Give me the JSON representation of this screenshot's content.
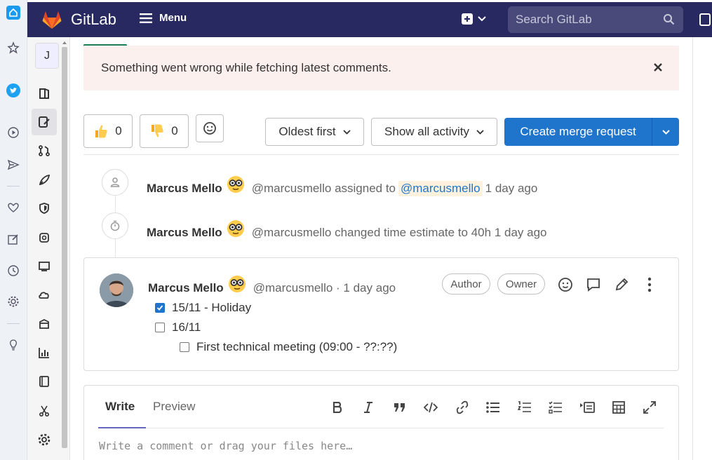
{
  "header": {
    "brand": "GitLab",
    "menu_label": "Menu",
    "search_placeholder": "Search GitLab"
  },
  "project": {
    "avatar_letter": "J"
  },
  "alert": {
    "message": "Something went wrong while fetching latest comments."
  },
  "toolbar": {
    "thumbs_up_count": "0",
    "thumbs_down_count": "0",
    "sort_label": "Oldest first",
    "filter_label": "Show all activity",
    "create_mr_label": "Create merge request"
  },
  "activity": [
    {
      "author": "Marcus Mello",
      "username": "@marcusmello",
      "action": "assigned to",
      "mention": "@marcusmello",
      "time": "1 day ago"
    },
    {
      "author": "Marcus Mello",
      "username": "@marcusmello",
      "action": "changed time estimate to 40h",
      "time": "1 day ago"
    }
  ],
  "note": {
    "author": "Marcus Mello",
    "meta": "@marcusmello · 1 day ago",
    "badges": [
      "Author",
      "Owner"
    ],
    "tasks": [
      {
        "text": "15/11 - Holiday",
        "checked": true
      },
      {
        "text": "16/11",
        "checked": false
      },
      {
        "text": "First technical meeting (09:00 - ??:??)",
        "checked": false
      }
    ]
  },
  "comment": {
    "tab_write": "Write",
    "tab_preview": "Preview",
    "placeholder": "Write a comment or drag your files here…"
  },
  "colors": {
    "header_bg": "#292961",
    "primary": "#1f75cb",
    "alert_bg": "#fbf0ee"
  }
}
